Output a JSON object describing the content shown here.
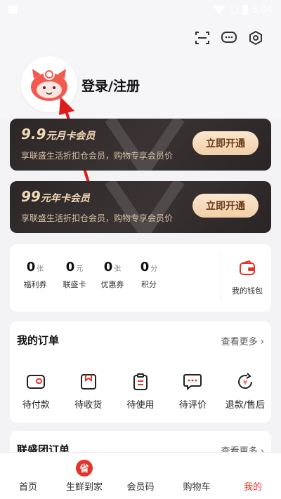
{
  "status": {
    "time": "5:04"
  },
  "profile": {
    "login_label": "登录/注册"
  },
  "header_icons": [
    "scan-icon",
    "message-icon",
    "settings-icon"
  ],
  "vip_cards": [
    {
      "title_big": "9.9",
      "title_rest": "元月卡会员",
      "subtitle": "享联盛生活折扣仓会员，购物专享会员价",
      "button": "立即开通"
    },
    {
      "title_big": "99",
      "title_rest": "元年卡会员",
      "subtitle": "享联盛生活折扣仓会员，购物专享会员价",
      "button": "立即开通"
    }
  ],
  "wallet": {
    "stats": [
      {
        "num": "0",
        "unit": "张",
        "label": "福利券"
      },
      {
        "num": "0",
        "unit": "元",
        "label": "联盛卡"
      },
      {
        "num": "0",
        "unit": "张",
        "label": "优惠券"
      },
      {
        "num": "0",
        "unit": "分",
        "label": "积分"
      }
    ],
    "my_wallet": "我的钱包"
  },
  "orders": {
    "title": "我的订单",
    "more": "查看更多",
    "items": [
      "待付款",
      "待收货",
      "待使用",
      "待评价",
      "退款/售后"
    ]
  },
  "group_orders": {
    "title": "联盛团订单",
    "more": "查看更多"
  },
  "tabbar": {
    "items": [
      "首页",
      "生鲜到家",
      "会员码",
      "购物车",
      "我的"
    ],
    "active_index": 4
  },
  "colors": {
    "accent": "#e6332a",
    "gold": "#f2d9b5",
    "dark_card": "#2c2627"
  }
}
